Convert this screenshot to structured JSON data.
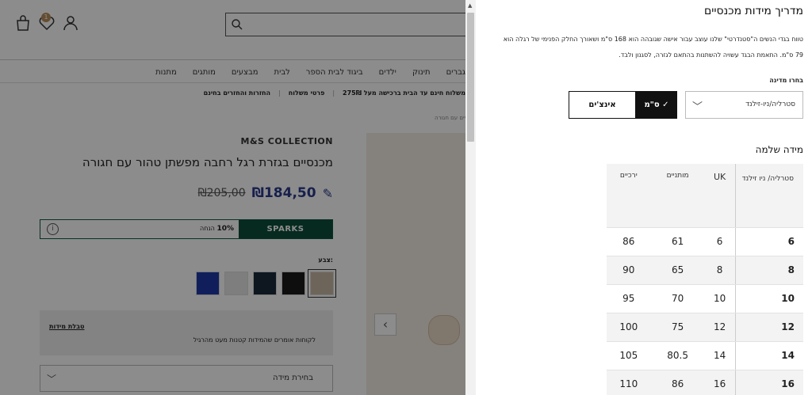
{
  "page": {
    "header": {
      "cart_icon": "shopping-bag-icon",
      "wishlist_icon": "heart-icon",
      "wishlist_count": "1",
      "account_icon": "user-icon",
      "search_icon": "search-icon"
    },
    "nav": [
      "מתנות",
      "מותגים",
      "מבצעים",
      "לבית",
      "ביגוד לבית הספר",
      "ילדים",
      "תינוק",
      "גברים"
    ],
    "promo": [
      "משלוח חינם עד הבית ברכישה מעל 275₪",
      "פרטי משלוח",
      "החזרות והחזרים בחינם"
    ],
    "breadcrumb": "מכנסיים עם חגורה",
    "product": {
      "brand": "M&S COLLECTION",
      "title": "מכנסיים בגזרת רגל רחבה מפשתן טהור עם חגורה",
      "price_now": "₪184,50",
      "price_was": "₪205,00",
      "sparks_label": "SPARKS",
      "sparks_discount_pct": "10%",
      "sparks_discount_word": "הנחה",
      "color_label": "צבע:",
      "colors": [
        "#c9b8a4",
        "#1b1b1b",
        "#1b2b3a",
        "#e6e6e6",
        "#1e3aa8"
      ],
      "size_chart_link": "טבלת מידות",
      "fit_note": "לקוחות אומרים שהמידות קטנות מעט מהרגיל",
      "size_select_label": "בחירת מידה"
    }
  },
  "size_guide": {
    "title": "מדריך מידות מכנסיים",
    "description": "טווח בגדי הנשים ה\"סטנדרטי\" שלנו עוצב עבור אישה שגובהה הוא 168 ס\"מ ושאורך החלק הפנימי של רגלה הוא 79 ס\"מ. התאמת הבגד עשויה להשתנות בהתאם לגזרה, לסגנון ולבד.",
    "country_label": "בחרו מדינה",
    "country_value": "סטרליה/ניו-זילנד",
    "unit_cm": "ס\"מ",
    "unit_inch": "אינצ'ים",
    "table_title": "מידה שלמה",
    "columns": [
      "סטרליה/ ניו זילנד",
      "UK",
      "מותניים",
      "ירכיים"
    ],
    "rows": [
      [
        "6",
        "6",
        "61",
        "86"
      ],
      [
        "8",
        "8",
        "65",
        "90"
      ],
      [
        "10",
        "10",
        "70",
        "95"
      ],
      [
        "12",
        "12",
        "75",
        "100"
      ],
      [
        "14",
        "14",
        "80.5",
        "105"
      ],
      [
        "16",
        "16",
        "86",
        "110"
      ]
    ]
  }
}
